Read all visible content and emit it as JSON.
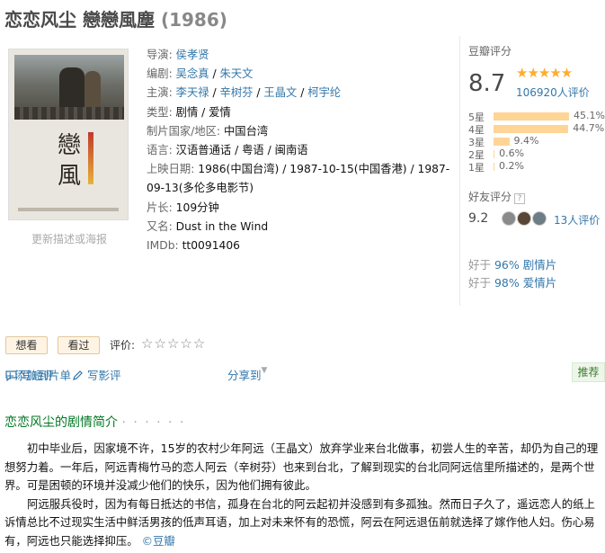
{
  "title": {
    "name": "恋恋风尘 戀戀風塵",
    "year": "(1986)"
  },
  "poster": {
    "edit_link": "更新描述或海报"
  },
  "info": {
    "director": {
      "label": "导演:",
      "names": [
        "侯孝贤"
      ]
    },
    "writer": {
      "label": "编剧:",
      "names": [
        "吴念真",
        "朱天文"
      ]
    },
    "cast": {
      "label": "主演:",
      "names": [
        "李天禄",
        "辛树芬",
        "王晶文",
        "柯宇纶"
      ]
    },
    "genre": {
      "label": "类型:",
      "value": "剧情 / 爱情"
    },
    "country": {
      "label": "制片国家/地区:",
      "value": "中国台湾"
    },
    "language": {
      "label": "语言:",
      "value": "汉语普通话 / 粤语 / 闽南语"
    },
    "release": {
      "label": "上映日期:",
      "value": "1986(中国台湾) / 1987-10-15(中国香港) / 1987-09-13(多伦多电影节)"
    },
    "runtime": {
      "label": "片长:",
      "value": "109分钟"
    },
    "aka": {
      "label": "又名:",
      "value": "Dust in the Wind"
    },
    "imdb": {
      "label": "IMDb:",
      "value": "tt0091406"
    }
  },
  "rating": {
    "label": "豆瓣评分",
    "score": "8.7",
    "stars": "★★★★★",
    "stars_value": 4.5,
    "count": "106920人评价",
    "distribution": [
      {
        "label": "5星",
        "pct": "45.1%",
        "value": 45.1
      },
      {
        "label": "4星",
        "pct": "44.7%",
        "value": 44.7
      },
      {
        "label": "3星",
        "pct": "9.4%",
        "value": 9.4
      },
      {
        "label": "2星",
        "pct": "0.6%",
        "value": 0.6
      },
      {
        "label": "1星",
        "pct": "0.2%",
        "value": 0.2
      }
    ],
    "bar_color": "#ffd596",
    "star_color": "#ffac2d"
  },
  "friends": {
    "label": "好友评分",
    "help": "?",
    "score": "9.2",
    "count": "13人评价"
  },
  "better_than": [
    {
      "prefix": "好于 ",
      "pct": "96%",
      "genre": " 剧情片"
    },
    {
      "prefix": "好于 ",
      "pct": "98%",
      "genre": " 爱情片"
    }
  ],
  "actions": {
    "want": "想看",
    "seen": "看过",
    "rate_label": "评价:",
    "rate_stars": "☆☆☆☆☆"
  },
  "tools": {
    "short_review": "写短评",
    "review": "写影评",
    "add_to_list": "+添加到片单",
    "share": "分享到",
    "recommend": "推荐"
  },
  "summary": {
    "title": "恋恋风尘的剧情简介",
    "dots": "· · · · · ·",
    "paragraph1": "初中毕业后，因家境不许，15岁的农村少年阿远（王晶文）放弃学业来台北做事，初尝人生的辛苦，却仍为自己的理想努力着。一年后，阿远青梅竹马的恋人阿云（辛树芬）也来到台北，了解到现实的台北同阿远信里所描述的，是两个世界。可是困顿的环境并没减少他们的快乐，因为他们拥有彼此。",
    "paragraph2": "阿远服兵役时，因为有每日抵达的书信，孤身在台北的阿云起初并没感到有多孤独。然而日子久了，遥远恋人的纸上诉情总比不过现实生活中鲜活男孩的低声耳语，加上对未来怀有的恐慌，阿云在阿远退伍前就选择了嫁作他人妇。伤心易有，阿远也只能选择抑压。",
    "copyright": "©豆瓣"
  }
}
